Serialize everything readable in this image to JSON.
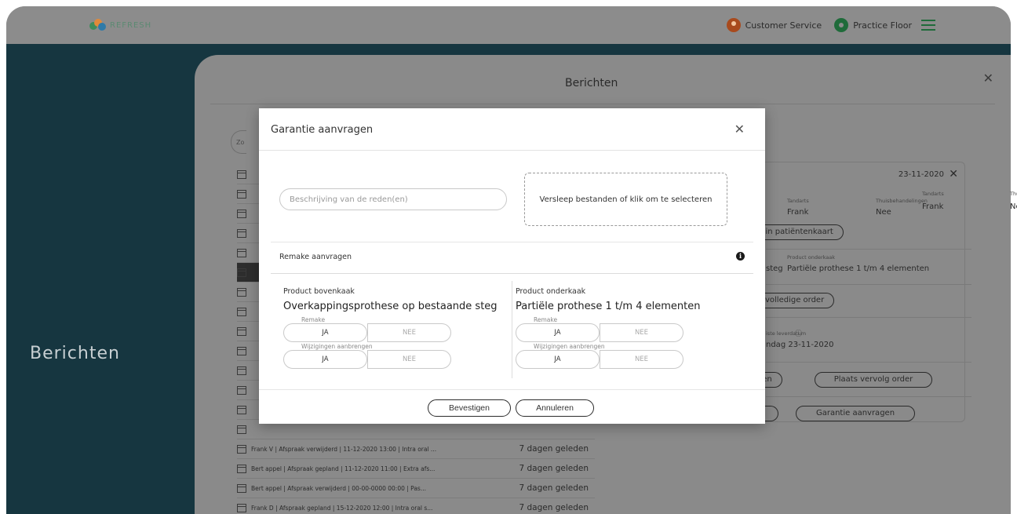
{
  "topbar": {
    "logo_text": "REFRESH",
    "user_label": "Customer Service",
    "location_label": "Practice Floor",
    "brand_color": "#1f6b3a"
  },
  "left": {
    "title": "Berichten"
  },
  "sheet": {
    "title": "Berichten",
    "search_stub": "Zo"
  },
  "messages": [
    {
      "text": "",
      "when": "",
      "dark": false
    },
    {
      "text": "",
      "when": "",
      "dark": false
    },
    {
      "text": "",
      "when": "",
      "dark": false
    },
    {
      "text": "",
      "when": "",
      "dark": false
    },
    {
      "text": "",
      "when": "",
      "dark": false
    },
    {
      "text": "",
      "when": "",
      "dark": true
    },
    {
      "text": "",
      "when": "",
      "dark": false
    },
    {
      "text": "",
      "when": "",
      "dark": false
    },
    {
      "text": "",
      "when": "",
      "dark": false
    },
    {
      "text": "",
      "when": "",
      "dark": false
    },
    {
      "text": "",
      "when": "",
      "dark": false
    },
    {
      "text": "",
      "when": "",
      "dark": false
    },
    {
      "text": "",
      "when": "",
      "dark": false
    },
    {
      "text": "",
      "when": "",
      "dark": false
    },
    {
      "text": "Frank V | Afspraak verwijderd | 11-12-2020 13:00 | Intra oral ...",
      "when": "7 dagen geleden",
      "dark": false
    },
    {
      "text": "Bert appel | Afspraak gepland | 11-12-2020 11:00 | Extra afs...",
      "when": "7 dagen geleden",
      "dark": false
    },
    {
      "text": "Bert appel | Afspraak verwijderd | 00-00-0000 00:00 | Pas...",
      "when": "7 dagen geleden",
      "dark": false
    },
    {
      "text": "Frank D | Afspraak gepland | 15-12-2020 12:00 | Intra oral s...",
      "when": "7 dagen geleden",
      "dark": false
    }
  ],
  "detail": {
    "date": "23-11-2020",
    "dentist_label": "Tandarts",
    "dentist_value": "Frank",
    "home_label": "Thuisbehandelingen",
    "home_value": "Nee",
    "patient_card_btn": "n in patiëntenkaart",
    "product_lower_label": "Product onderkaak",
    "product_left_value": "steg",
    "product_lower_value": "Partiële prothese 1 t/m 4 elementen",
    "full_order_btn": "k volledige order",
    "delivery_label": "iste leverdatum",
    "delivery_value": "ndag 23-11-2020",
    "btn_partial": "sen",
    "btn_follow_order": "Plaats vervolg order",
    "btn_warranty": "Garantie aanvragen"
  },
  "modal": {
    "title": "Garantie aanvragen",
    "reason_placeholder": "Beschrijving van de reden(en)",
    "dropzone_text": "Versleep bestanden of klik om te selecteren",
    "remake_title": "Remake aanvragen",
    "upper": {
      "label": "Product bovenkaak",
      "product": "Overkappingsprothese op bestaande steg",
      "remake_legend": "Remake",
      "changes_legend": "Wijzigingen aanbrengen",
      "yes": "JA",
      "no": "NEE"
    },
    "lower": {
      "label": "Product onderkaak",
      "product": "Partiële prothese 1 t/m 4 elementen",
      "remake_legend": "Remake",
      "changes_legend": "Wijzigingen aanbrengen",
      "yes": "JA",
      "no": "NEE"
    },
    "confirm_label": "Bevestigen",
    "cancel_label": "Annuleren"
  }
}
